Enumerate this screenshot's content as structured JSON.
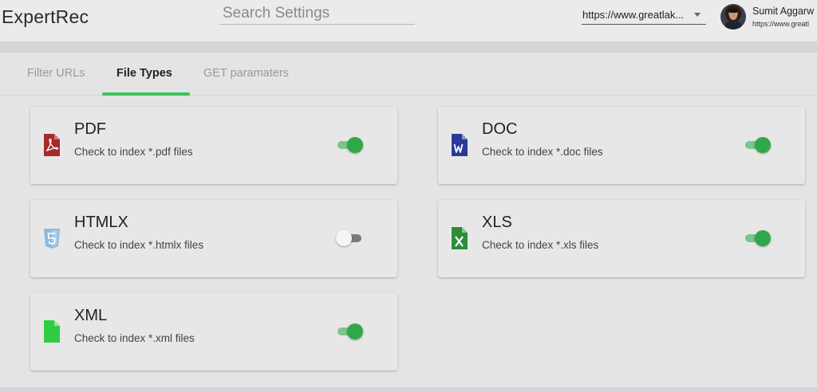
{
  "app": {
    "title": "ExpertRec"
  },
  "search": {
    "placeholder": "Search Settings",
    "value": ""
  },
  "site_selector": {
    "value": "https://www.greatlak..."
  },
  "user": {
    "name": "Sumit Aggarw",
    "url": "https://www.greatl"
  },
  "tabs": [
    {
      "label": "Filter URLs",
      "active": false
    },
    {
      "label": "File Types",
      "active": true
    },
    {
      "label": "GET paramaters",
      "active": false
    }
  ],
  "file_types": [
    {
      "title": "PDF",
      "description": "Check to index *.pdf files",
      "enabled": true,
      "icon": "pdf-file-icon",
      "icon_color": "#a52a2a"
    },
    {
      "title": "DOC",
      "description": "Check to index *.doc files",
      "enabled": true,
      "icon": "word-file-icon",
      "icon_color": "#2b3a9a"
    },
    {
      "title": "HTMLX",
      "description": "Check to index *.htmlx files",
      "enabled": false,
      "icon": "html5-icon",
      "icon_color": "#8fb8d8"
    },
    {
      "title": "XLS",
      "description": "Check to index *.xls files",
      "enabled": true,
      "icon": "excel-file-icon",
      "icon_color": "#2e8b3a"
    },
    {
      "title": "XML",
      "description": "Check to index *.xml files",
      "enabled": true,
      "icon": "xml-file-icon",
      "icon_color": "#2ecc40"
    }
  ],
  "colors": {
    "accent": "#3cc35f",
    "toggle_on": "#2fa84a",
    "toggle_track_on": "#7dc58a"
  }
}
